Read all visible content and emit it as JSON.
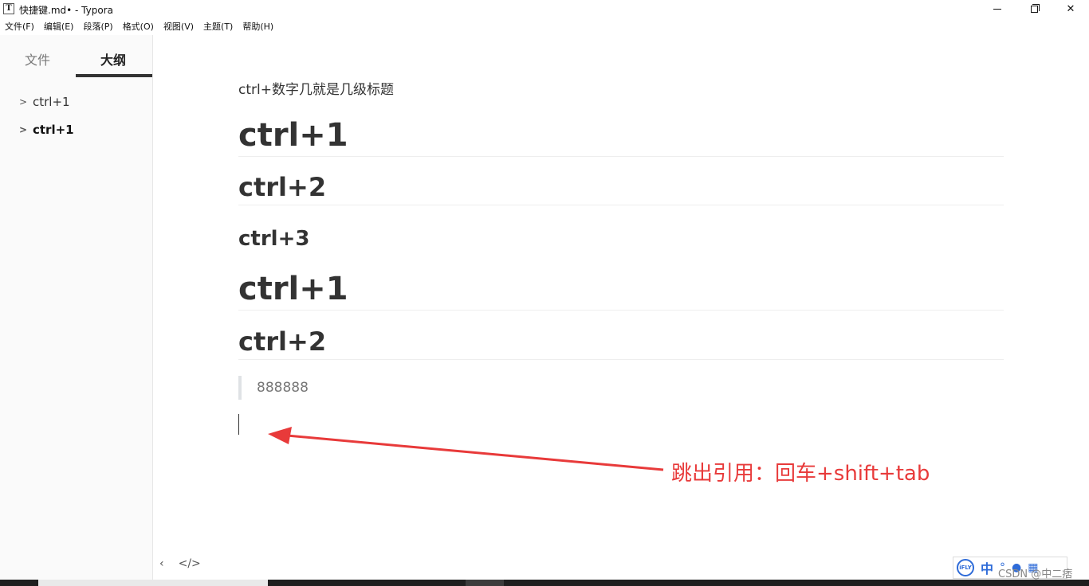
{
  "window": {
    "app_icon_letter": "T",
    "title": "快捷键.md• - Typora"
  },
  "menu": [
    "文件(F)",
    "编辑(E)",
    "段落(P)",
    "格式(O)",
    "视图(V)",
    "主题(T)",
    "帮助(H)"
  ],
  "sidebar": {
    "tabs": {
      "files": "文件",
      "outline": "大纲",
      "active": "outline"
    },
    "outline_items": [
      {
        "label": "ctrl+1",
        "bold": false
      },
      {
        "label": "ctrl+1",
        "bold": true
      }
    ],
    "footer": {
      "back_glyph": "‹",
      "source_glyph": "</>"
    }
  },
  "document": {
    "paragraph": "ctrl+数字几就是几级标题",
    "headings": [
      {
        "level": 1,
        "text": "ctrl+1"
      },
      {
        "level": 2,
        "text": "ctrl+2"
      },
      {
        "level": 3,
        "text": "ctrl+3"
      },
      {
        "level": 1,
        "text": "ctrl+1"
      },
      {
        "level": 2,
        "text": "ctrl+2"
      }
    ],
    "blockquote": "888888"
  },
  "annotation": {
    "text": "跳出引用：回车+shift+tab",
    "color": "#e83a3a"
  },
  "ime": {
    "logo": "iFLY",
    "mode": "中",
    "icons": [
      "dot-icon",
      "mic-icon",
      "grid-icon"
    ]
  },
  "watermark": "CSDN @中二痞"
}
